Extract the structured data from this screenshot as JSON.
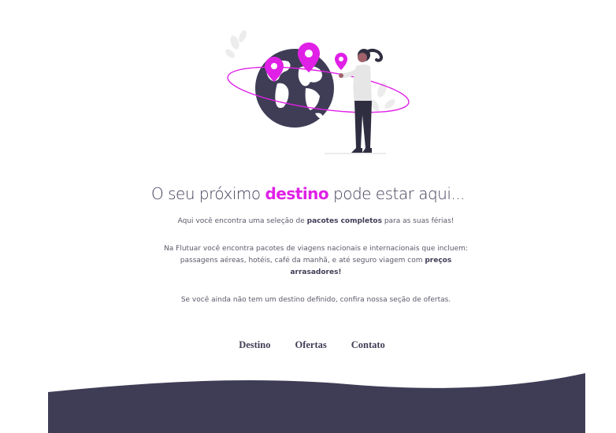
{
  "headline": {
    "before": "O seu próximo ",
    "accent": "destino",
    "after": " pode estar aqui..."
  },
  "intro": {
    "before": "Aqui você encontra uma seleção de ",
    "bold": "pacotes completos",
    "after": " para as suas férias!"
  },
  "details": {
    "before": "Na Flutuar você encontra pacotes de viagens nacionais e internacionais que incluem: passagens aéreas, hotéis, café da manhã, e até seguro viagem com ",
    "bold": "preços arrasadores!"
  },
  "closing": "Se você ainda não tem um destino definido, confira nossa seção de ofertas.",
  "nav": {
    "destino": "Destino",
    "ofertas": "Ofertas",
    "contato": "Contato"
  },
  "colors": {
    "accent": "#e020e6",
    "dark": "#3f3d56",
    "text": "#5b5a6a"
  },
  "illustration": "woman-holding-map-pin-by-globe-illustration"
}
